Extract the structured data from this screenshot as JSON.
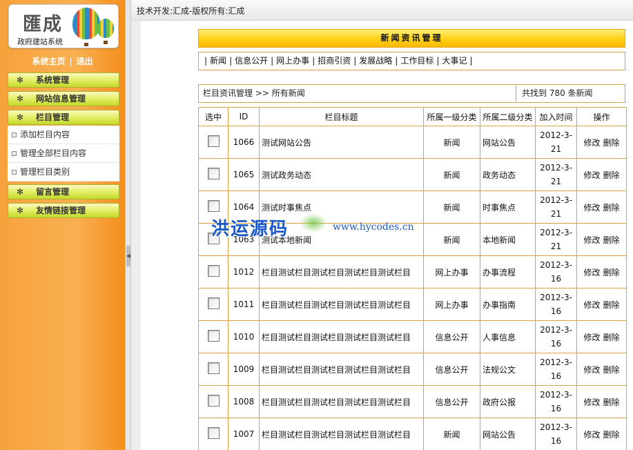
{
  "logo": {
    "title": "匯成",
    "subtitle": "政府建站系统"
  },
  "sys_links": {
    "home": "系统主页",
    "sep": "|",
    "logout": "退出"
  },
  "sidebar": {
    "menus": [
      {
        "label": "系统管理"
      },
      {
        "label": "网站信息管理"
      },
      {
        "label": "栏目管理"
      },
      {
        "label": "留言管理"
      },
      {
        "label": "友情链接管理"
      }
    ],
    "submenu": [
      {
        "label": "添加栏目内容"
      },
      {
        "label": "管理全部栏目内容"
      },
      {
        "label": "管理栏目类别"
      }
    ]
  },
  "topbar": {
    "text": "技术开发:汇成-版权所有:汇成"
  },
  "banner": {
    "title": "新闻资讯管理"
  },
  "nav": {
    "items": [
      "新闻",
      "信息公开",
      "网上办事",
      "招商引资",
      "发展战略",
      "工作目标",
      "大事记"
    ]
  },
  "info": {
    "breadcrumb": "栏目资讯管理 >> 所有新闻",
    "count": "共找到 780 条新闻"
  },
  "table": {
    "headers": [
      "选中",
      "ID",
      "栏目标题",
      "所属一级分类",
      "所属二级分类",
      "加入时间",
      "操作"
    ],
    "edit_label": "修改",
    "delete_label": "删除",
    "rows": [
      {
        "id": "1066",
        "title": "测试网站公告",
        "cat1": "新闻",
        "cat2": "网站公告",
        "date": "2012-3-21"
      },
      {
        "id": "1065",
        "title": "测试政务动态",
        "cat1": "新闻",
        "cat2": "政务动态",
        "date": "2012-3-21"
      },
      {
        "id": "1064",
        "title": "测试时事焦点",
        "cat1": "新闻",
        "cat2": "时事焦点",
        "date": "2012-3-21"
      },
      {
        "id": "1063",
        "title": "测试本地新闻",
        "cat1": "新闻",
        "cat2": "本地新闻",
        "date": "2012-3-21"
      },
      {
        "id": "1012",
        "title": "栏目测试栏目测试栏目测试栏目测试栏目",
        "cat1": "网上办事",
        "cat2": "办事流程",
        "date": "2012-3-16"
      },
      {
        "id": "1011",
        "title": "栏目测试栏目测试栏目测试栏目测试栏目",
        "cat1": "网上办事",
        "cat2": "办事指南",
        "date": "2012-3-16"
      },
      {
        "id": "1010",
        "title": "栏目测试栏目测试栏目测试栏目测试栏目",
        "cat1": "信息公开",
        "cat2": "人事信息",
        "date": "2012-3-16"
      },
      {
        "id": "1009",
        "title": "栏目测试栏目测试栏目测试栏目测试栏目",
        "cat1": "信息公开",
        "cat2": "法规公文",
        "date": "2012-3-16"
      },
      {
        "id": "1008",
        "title": "栏目测试栏目测试栏目测试栏目测试栏目",
        "cat1": "信息公开",
        "cat2": "政府公报",
        "date": "2012-3-16"
      },
      {
        "id": "1007",
        "title": "栏目测试栏目测试栏目测试栏目测试栏目",
        "cat1": "新闻",
        "cat2": "网站公告",
        "date": "2012-3-16"
      }
    ]
  },
  "watermark": {
    "cn": "洪运源码",
    "url": "www.hycodes.cn"
  }
}
